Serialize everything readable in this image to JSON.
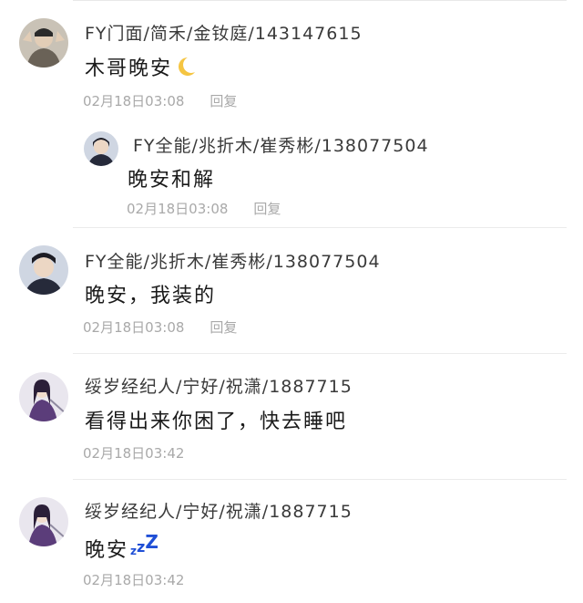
{
  "comments": [
    {
      "user": "FY门面/简禾/金钕庭/143147615",
      "text": "木哥晚安",
      "emoji": "crescent-moon",
      "time": "02月18日03:08",
      "reply_label": "回复",
      "replies": [
        {
          "user": "FY全能/兆折木/崔秀彬/138077504",
          "text": "晚安和解",
          "time": "02月18日03:08",
          "reply_label": "回复"
        }
      ]
    },
    {
      "user": "FY全能/兆折木/崔秀彬/138077504",
      "text": "晚安，我装的",
      "time": "02月18日03:08",
      "reply_label": "回复"
    },
    {
      "user": "绥岁经纪人/宁好/祝潇/1887715",
      "text": "看得出来你困了，快去睡吧",
      "time": "02月18日03:42"
    },
    {
      "user": "绥岁经纪人/宁好/祝潇/1887715",
      "text": "晚安",
      "emoji": "zzz",
      "time": "02月18日03:42"
    }
  ],
  "colors": {
    "name": "#3a3a3a",
    "text": "#1a1a1a",
    "meta": "#a9a9a9",
    "divider": "#ebebeb",
    "zzz": "#1f4fd6",
    "moon": "#f5c542"
  }
}
